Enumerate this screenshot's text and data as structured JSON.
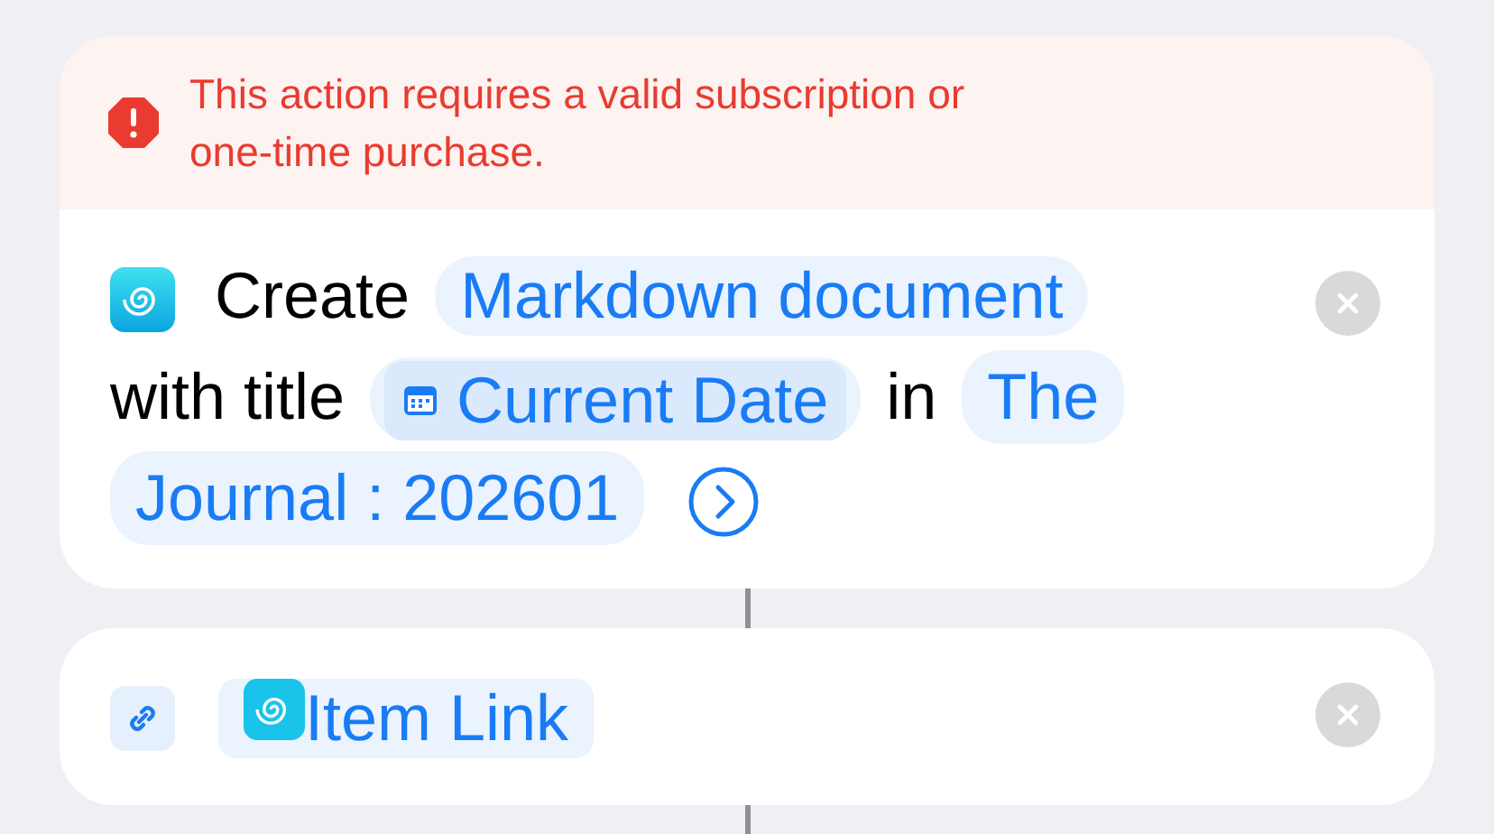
{
  "warning": {
    "message": "This action requires a valid subscription or one-time purchase."
  },
  "actions": [
    {
      "kind": "create",
      "parts": [
        {
          "kind": "text",
          "text": "Create"
        },
        {
          "kind": "token",
          "text": "Markdown document"
        },
        {
          "kind": "text",
          "text": "with title"
        },
        {
          "kind": "date-variable",
          "text": "Current Date"
        },
        {
          "kind": "text",
          "text": "in"
        },
        {
          "kind": "token",
          "text": "The Journal : 202601"
        }
      ]
    },
    {
      "kind": "link",
      "parts": [
        {
          "kind": "app-variable",
          "text": "Item Link"
        }
      ]
    }
  ]
}
